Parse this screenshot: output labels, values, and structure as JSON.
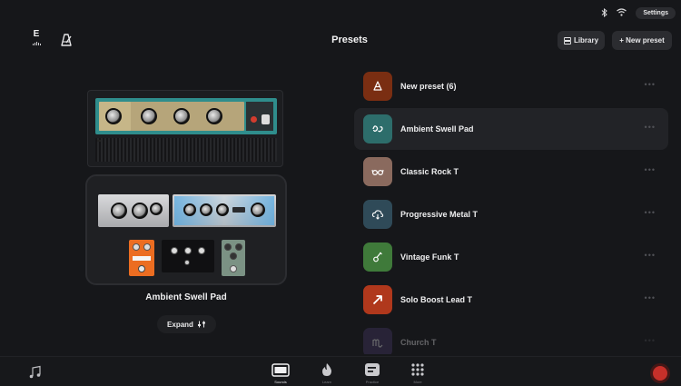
{
  "status_bar": {
    "bluetooth_icon": "bluetooth-icon",
    "wifi_icon": "wifi-icon",
    "settings_label": "Settings"
  },
  "header": {
    "tuner_letter": "E",
    "title": "Presets",
    "library_label": "Library",
    "new_preset_label": "+ New preset"
  },
  "rig": {
    "name": "Ambient Swell Pad",
    "expand_label": "Expand"
  },
  "presets": [
    {
      "label": "New preset (6)",
      "icon": "pick-icon",
      "color": "#7a2e12"
    },
    {
      "label": "Ambient Swell Pad",
      "icon": "wave-icon",
      "color": "#2d6d6b",
      "selected": true
    },
    {
      "label": "Classic Rock T",
      "icon": "glasses-icon",
      "color": "#8a6a5e"
    },
    {
      "label": "Progressive Metal T",
      "icon": "cloud-download-icon",
      "color": "#2f4a58"
    },
    {
      "label": "Vintage Funk T",
      "icon": "guitar-icon",
      "color": "#3f7a3a"
    },
    {
      "label": "Solo Boost Lead T",
      "icon": "arrow-icon",
      "color": "#b0381c"
    },
    {
      "label": "Church T",
      "icon": "scorpio-icon",
      "color": "#4a3a6e"
    }
  ],
  "bottom_tabs": [
    {
      "label": "Sounds",
      "icon": "amp-icon",
      "active": true
    },
    {
      "label": "Learn",
      "icon": "flame-icon",
      "active": false
    },
    {
      "label": "Practice",
      "icon": "practice-icon",
      "active": false
    },
    {
      "label": "More",
      "icon": "grid-icon",
      "active": false
    }
  ],
  "colors": {
    "background": "#16171a",
    "accent_record": "#c7302a"
  }
}
